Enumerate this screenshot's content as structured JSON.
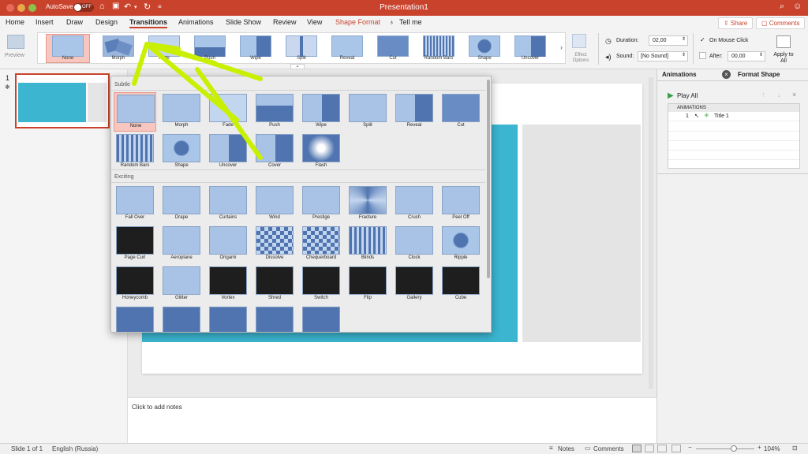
{
  "titlebar": {
    "autosave": "AutoSave",
    "autosave_state": "OFF",
    "title": "Presentation1"
  },
  "tabs": [
    "Home",
    "Insert",
    "Draw",
    "Design",
    "Transitions",
    "Animations",
    "Slide Show",
    "Review",
    "View",
    "Shape Format",
    "Tell me"
  ],
  "active_tab": "Transitions",
  "share_label": "Share",
  "comments_label": "Comments",
  "ribbon": {
    "preview_label": "Preview",
    "transitions": [
      "None",
      "Morph",
      "Fade",
      "Push",
      "Wipe",
      "Split",
      "Reveal",
      "Cut",
      "Random Bars",
      "Shape",
      "Uncover"
    ],
    "effect_options_label": "Effect Options",
    "duration_label": "Duration:",
    "duration_value": "02,00",
    "sound_label": "Sound:",
    "sound_value": "[No Sound]",
    "on_mouse_click_label": "On Mouse Click",
    "on_mouse_click_checked": true,
    "after_label": "After:",
    "after_value": "00,00",
    "apply_to_all_label": "Apply to All"
  },
  "gallery": {
    "sections": [
      {
        "title": "Subtle",
        "items": [
          "None",
          "Morph",
          "Fade",
          "Push",
          "Wipe",
          "Split",
          "Reveal",
          "Cut",
          "Random Bars",
          "Shape",
          "Uncover",
          "Cover",
          "Flash"
        ]
      },
      {
        "title": "Exciting",
        "items": [
          "Fall Over",
          "Drape",
          "Curtains",
          "Wind",
          "Prestige",
          "Fracture",
          "Crush",
          "Peel Off",
          "Page Curl",
          "Aeroplane",
          "Origami",
          "Dissolve",
          "Chequerboard",
          "Blinds",
          "Clock",
          "Ripple",
          "Honeycomb",
          "Glitter",
          "Vortex",
          "Shred",
          "Switch",
          "Flip",
          "Gallery",
          "Cube",
          "",
          "",
          "",
          "",
          ""
        ]
      }
    ],
    "selected": "None"
  },
  "slides_panel": {
    "slide_number": "1"
  },
  "notes_placeholder": "Click to add notes",
  "right_pane": {
    "tab_animations": "Animations",
    "tab_format_shape": "Format Shape",
    "play_all_label": "Play All",
    "list_header": "ANIMATIONS",
    "entries": [
      {
        "number": "1",
        "name": "Title 1"
      }
    ]
  },
  "status": {
    "slide_info": "Slide 1 of 1",
    "language": "English (Russia)",
    "notes_label": "Notes",
    "comments_label": "Comments",
    "zoom": "104%"
  },
  "colors": {
    "accent": "#c9432c",
    "slide_fill": "#3bb5d0",
    "annotation_arrow": "#c8f000"
  }
}
